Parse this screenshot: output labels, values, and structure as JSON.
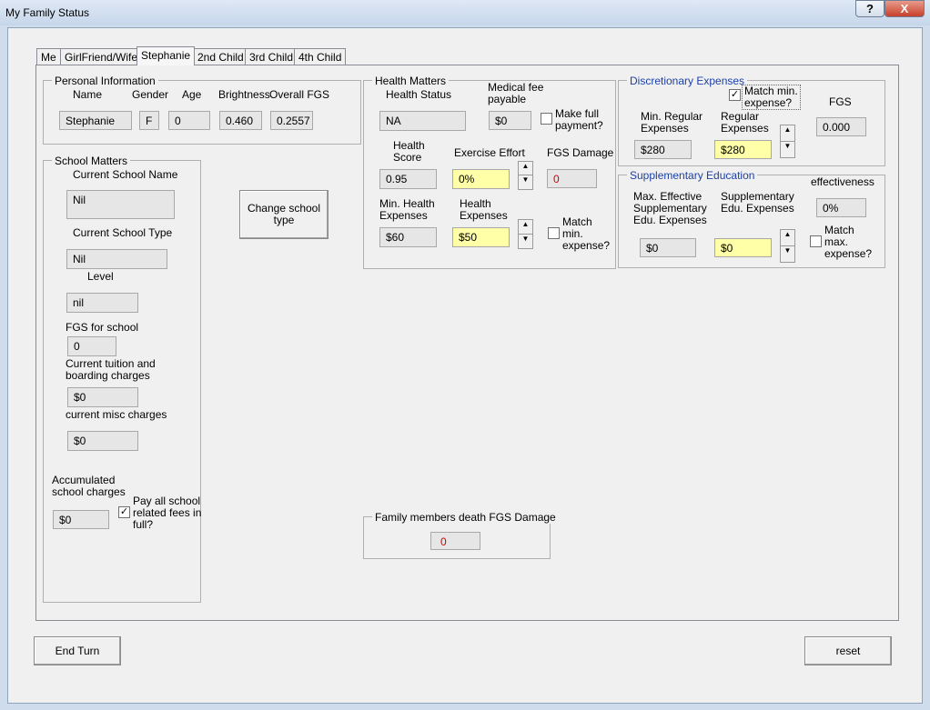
{
  "window": {
    "title": "My Family Status",
    "help_label": "?",
    "close_label": "X"
  },
  "tabs": [
    "Me",
    "GirlFriend/Wife",
    "Stephanie",
    "2nd Child",
    "3rd Child",
    "4th Child"
  ],
  "personal": {
    "title": "Personal Information",
    "name_label": "Name",
    "gender_label": "Gender",
    "age_label": "Age",
    "brightness_label": "Brightness",
    "fgs_label": "Overall FGS",
    "name": "Stephanie",
    "gender": "F",
    "age": "0",
    "brightness": "0.460",
    "fgs": "0.2557"
  },
  "school": {
    "title": "School Matters",
    "name_label": "Current School Name",
    "name": "Nil",
    "type_label": "Current School Type",
    "type": "Nil",
    "level_label": "Level",
    "level": "nil",
    "fgs_label": "FGS for school",
    "fgs": "0",
    "tuition_label_1": "Current tuition and",
    "tuition_label_2": "boarding charges",
    "tuition": "$0",
    "misc_label": "current misc charges",
    "misc": "$0",
    "accum_label_1": "Accumulated",
    "accum_label_2": "school charges",
    "accum": "$0",
    "payall_label_1": "Pay all school",
    "payall_label_2": "related fees in",
    "payall_label_3": "full?",
    "payall_checked": "✓",
    "change_label_1": "Change school",
    "change_label_2": "type"
  },
  "health": {
    "title": "Health Matters",
    "status_label": "Health Status",
    "status": "NA",
    "fee_label_1": "Medical fee",
    "fee_label_2": "payable",
    "fee": "$0",
    "fullpay_label_1": "Make full",
    "fullpay_label_2": "payment?",
    "score_label_1": "Health",
    "score_label_2": "Score",
    "score": "0.95",
    "effort_label": "Exercise Effort",
    "effort": "0%",
    "damage_label": "FGS Damage",
    "damage": "0",
    "minexp_label_1": "Min. Health",
    "minexp_label_2": "Expenses",
    "minexp": "$60",
    "exp_label_1": "Health",
    "exp_label_2": "Expenses",
    "exp": "$50",
    "match_label_1": "Match",
    "match_label_2": "min.",
    "match_label_3": "expense?"
  },
  "discretionary": {
    "title": "Discretionary Expenses",
    "match_label_1": "Match min.",
    "match_label_2": "expense?",
    "match_checked": "✓",
    "fgs_label": "FGS",
    "fgs": "0.000",
    "minreg_label_1": "Min. Regular",
    "minreg_label_2": "Expenses",
    "minreg": "$280",
    "reg_label_1": "Regular",
    "reg_label_2": "Expenses",
    "reg": "$280"
  },
  "supplementary": {
    "title": "Supplementary Education",
    "eff_label": "effectiveness",
    "eff": "0%",
    "max_label_1": "Max. Effective",
    "max_label_2": "Supplementary",
    "max_label_3": "Edu. Expenses",
    "max": "$0",
    "sup_label_1": "Supplementary",
    "sup_label_2": "Edu. Expenses",
    "sup": "$0",
    "match_label_1": "Match",
    "match_label_2": "max.",
    "match_label_3": "expense?"
  },
  "death": {
    "title": "Family members death FGS Damage",
    "value": "0"
  },
  "buttons": {
    "end_turn": "End Turn",
    "reset": "reset"
  },
  "spin": {
    "up": "▲",
    "down": "▼"
  }
}
